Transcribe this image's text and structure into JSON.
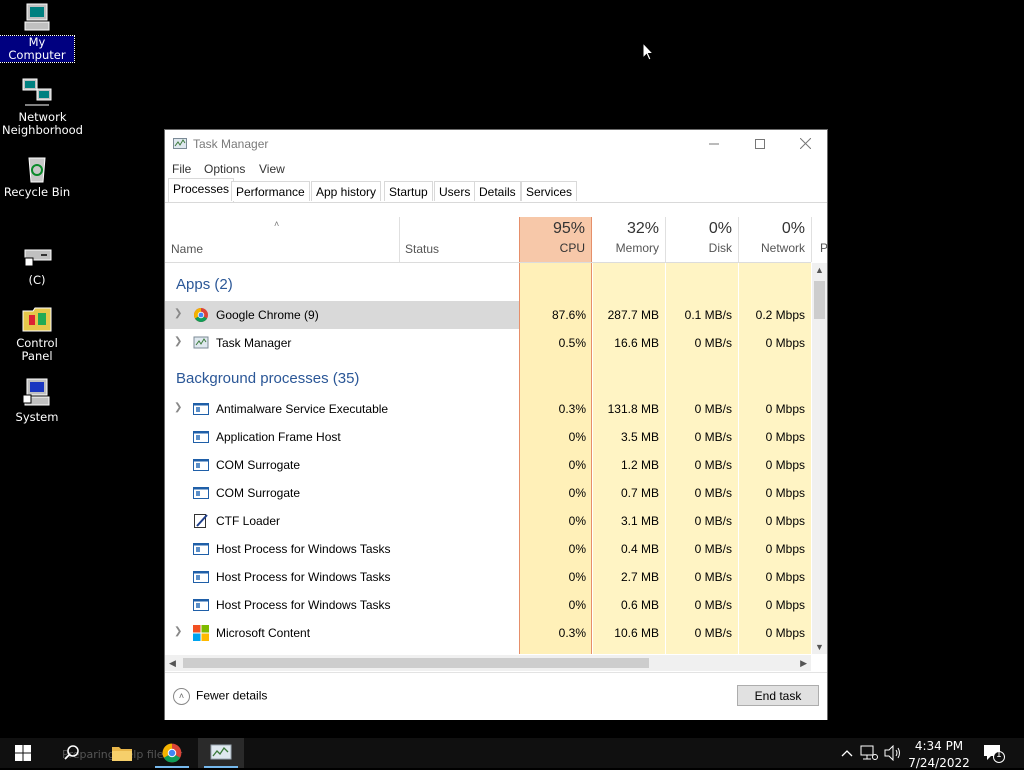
{
  "desktop": {
    "icons": [
      {
        "label": "My Computer",
        "icon": "my-computer-icon"
      },
      {
        "label": "Network Neighborhood",
        "icon": "network-icon"
      },
      {
        "label": "Recycle Bin",
        "icon": "recycle-bin-icon"
      },
      {
        "label": "(C)",
        "icon": "drive-shortcut-icon"
      },
      {
        "label": "Control Panel",
        "icon": "control-panel-icon"
      },
      {
        "label": "System",
        "icon": "system-icon"
      }
    ]
  },
  "window": {
    "title": "Task Manager",
    "menu": [
      "File",
      "Options",
      "View"
    ],
    "tabs": [
      "Processes",
      "Performance",
      "App history",
      "Startup",
      "Users",
      "Details",
      "Services"
    ],
    "active_tab": "Processes",
    "columns": {
      "name": "Name",
      "status": "Status",
      "cpu": {
        "pct": "95%",
        "label": "CPU"
      },
      "memory": {
        "pct": "32%",
        "label": "Memory"
      },
      "disk": {
        "pct": "0%",
        "label": "Disk"
      },
      "network": {
        "pct": "0%",
        "label": "Network"
      },
      "power_partial": "P"
    },
    "groups": {
      "apps": "Apps (2)",
      "background": "Background processes (35)"
    },
    "apps": [
      {
        "name": "Google Chrome (9)",
        "cpu": "87.6%",
        "memory": "287.7 MB",
        "disk": "0.1 MB/s",
        "network": "0.2 Mbps",
        "expandable": true
      },
      {
        "name": "Task Manager",
        "cpu": "0.5%",
        "memory": "16.6 MB",
        "disk": "0 MB/s",
        "network": "0 Mbps",
        "expandable": true
      }
    ],
    "background": [
      {
        "name": "Antimalware Service Executable",
        "cpu": "0.3%",
        "memory": "131.8 MB",
        "disk": "0 MB/s",
        "network": "0 Mbps",
        "expandable": true
      },
      {
        "name": "Application Frame Host",
        "cpu": "0%",
        "memory": "3.5 MB",
        "disk": "0 MB/s",
        "network": "0 Mbps",
        "expandable": false
      },
      {
        "name": "COM Surrogate",
        "cpu": "0%",
        "memory": "1.2 MB",
        "disk": "0 MB/s",
        "network": "0 Mbps",
        "expandable": false
      },
      {
        "name": "COM Surrogate",
        "cpu": "0%",
        "memory": "0.7 MB",
        "disk": "0 MB/s",
        "network": "0 Mbps",
        "expandable": false
      },
      {
        "name": "CTF Loader",
        "cpu": "0%",
        "memory": "3.1 MB",
        "disk": "0 MB/s",
        "network": "0 Mbps",
        "expandable": false
      },
      {
        "name": "Host Process for Windows Tasks",
        "cpu": "0%",
        "memory": "0.4 MB",
        "disk": "0 MB/s",
        "network": "0 Mbps",
        "expandable": false
      },
      {
        "name": "Host Process for Windows Tasks",
        "cpu": "0%",
        "memory": "2.7 MB",
        "disk": "0 MB/s",
        "network": "0 Mbps",
        "expandable": false
      },
      {
        "name": "Host Process for Windows Tasks",
        "cpu": "0%",
        "memory": "0.6 MB",
        "disk": "0 MB/s",
        "network": "0 Mbps",
        "expandable": false
      },
      {
        "name": "Microsoft Content",
        "cpu": "0.3%",
        "memory": "10.6 MB",
        "disk": "0 MB/s",
        "network": "0 Mbps",
        "expandable": true
      }
    ],
    "footer": {
      "fewer_details": "Fewer details",
      "end_task": "End task"
    }
  },
  "taskbar": {
    "ghost_text": "Preparing Help file for",
    "time": "4:34 PM",
    "date": "7/24/2022",
    "notification_count": "1"
  },
  "colors": {
    "cpu_header": "#f7c8a9",
    "cpu_column": "#fff0b8",
    "heat_column": "#fff4c4",
    "group_heading": "#2b5797",
    "selected_row": "#d9d9d9"
  }
}
